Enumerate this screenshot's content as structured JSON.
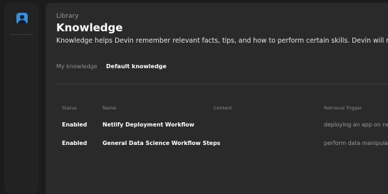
{
  "sidebar": {
    "avatar_icon": "user-avatar-icon"
  },
  "header": {
    "breadcrumb": "Library",
    "title": "Knowledge",
    "description": "Knowledge helps Devin remember relevant facts, tips, and how to perform certain skills. Devin will recall relevant"
  },
  "tabs": [
    {
      "label": "My knowledge",
      "active": false
    },
    {
      "label": "Default knowledge",
      "active": true
    }
  ],
  "table": {
    "columns": [
      "Status",
      "Name",
      "Content",
      "Retrieval Trigger"
    ],
    "rows": [
      {
        "status": "Enabled",
        "name": "Netlify Deployment Workflow",
        "content": "",
        "trigger": "deploying an app on netl"
      },
      {
        "status": "Enabled",
        "name": "General Data Science Workflow Steps",
        "content": "",
        "trigger": "perform data manipulatio"
      }
    ]
  },
  "colors": {
    "background": "#1c1c1c",
    "panel": "#2a2a2a",
    "avatar_accent": "#3b8dd6"
  }
}
